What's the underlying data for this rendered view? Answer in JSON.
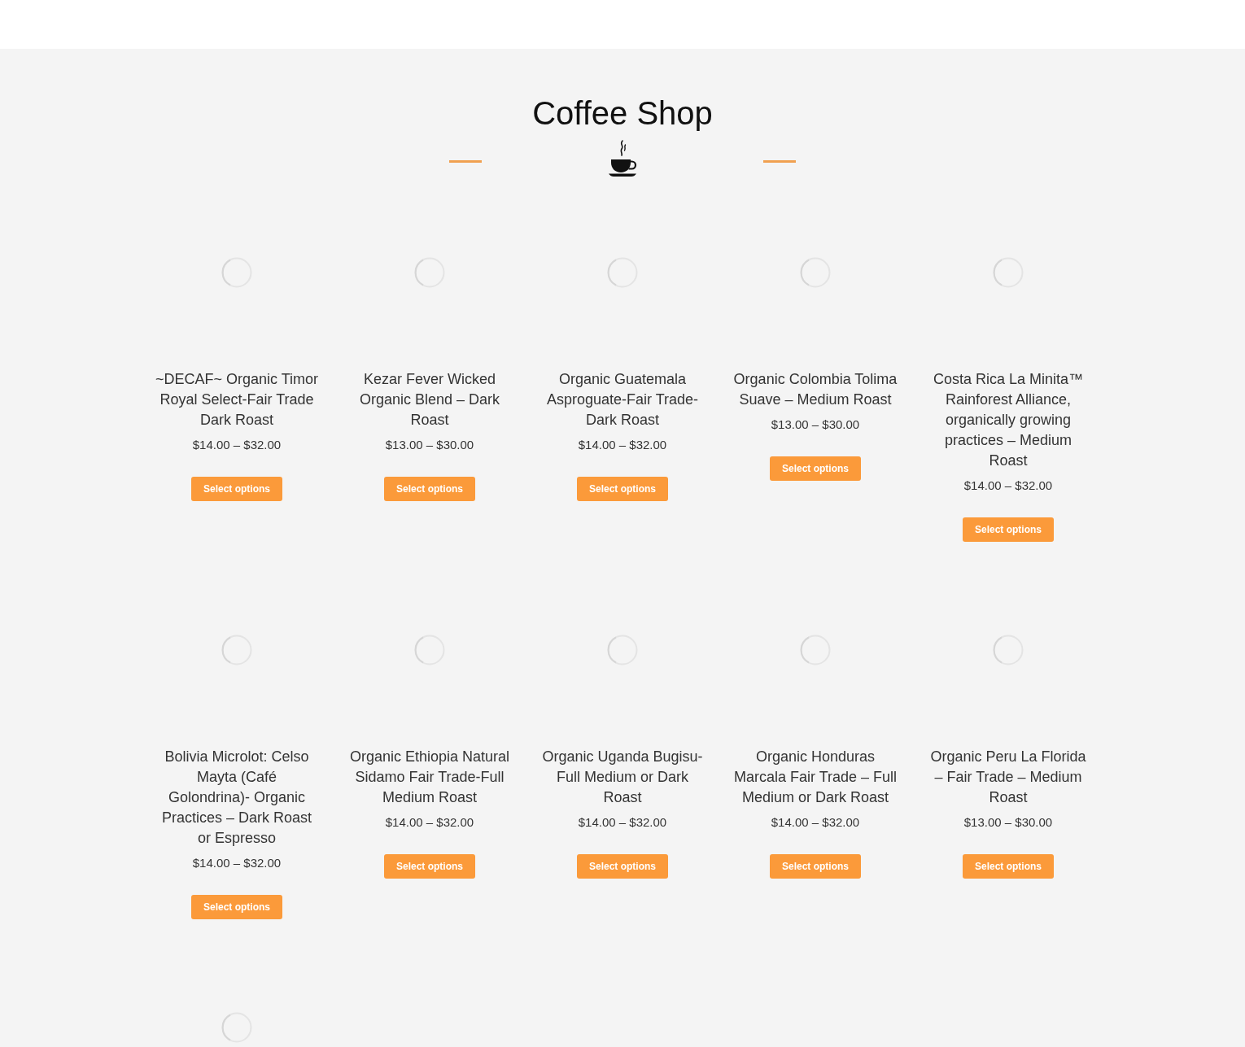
{
  "section": {
    "title": "Coffee Shop"
  },
  "products": [
    {
      "image_loading": true,
      "title": "~DECAF~ Organic Timor Royal Select-Fair Trade Dark Roast",
      "price": "$14.00 – $32.00",
      "button": "Select options"
    },
    {
      "image_loading": true,
      "title": "Kezar Fever Wicked Organic Blend – Dark Roast",
      "price": "$13.00 – $30.00",
      "button": "Select options"
    },
    {
      "image_loading": true,
      "title": "Organic Guatemala Asproguate-Fair Trade-Dark Roast",
      "price": "$14.00 – $32.00",
      "button": "Select options"
    },
    {
      "image_loading": true,
      "title": "Organic Colombia Tolima Suave – Medium Roast",
      "price": "$13.00 – $30.00",
      "button": "Select options"
    },
    {
      "image_loading": true,
      "title": "Costa Rica La Minita™ Rainforest Alliance, organically growing practices – Medium Roast",
      "price": "$14.00 – $32.00",
      "button": "Select options"
    },
    {
      "image_loading": true,
      "title": "Bolivia Microlot: Celso Mayta (Café Golondrina)- Organic Practices – Dark Roast or Espresso",
      "price": "$14.00 – $32.00",
      "button": "Select options"
    },
    {
      "image_loading": true,
      "title": "Organic Ethiopia Natural Sidamo Fair Trade-Full Medium Roast",
      "price": "$14.00 – $32.00",
      "button": "Select options"
    },
    {
      "image_loading": true,
      "title": "Organic Uganda Bugisu-Full Medium or Dark Roast",
      "price": "$14.00 – $32.00",
      "button": "Select options"
    },
    {
      "image_loading": true,
      "title": "Organic Honduras Marcala Fair Trade – Full Medium or Dark Roast",
      "price": "$14.00 – $32.00",
      "button": "Select options"
    },
    {
      "image_loading": true,
      "title": "Organic Peru La Florida – Fair Trade – Medium Roast",
      "price": "$13.00 – $30.00",
      "button": "Select options"
    },
    {
      "image_loading": true
    }
  ]
}
